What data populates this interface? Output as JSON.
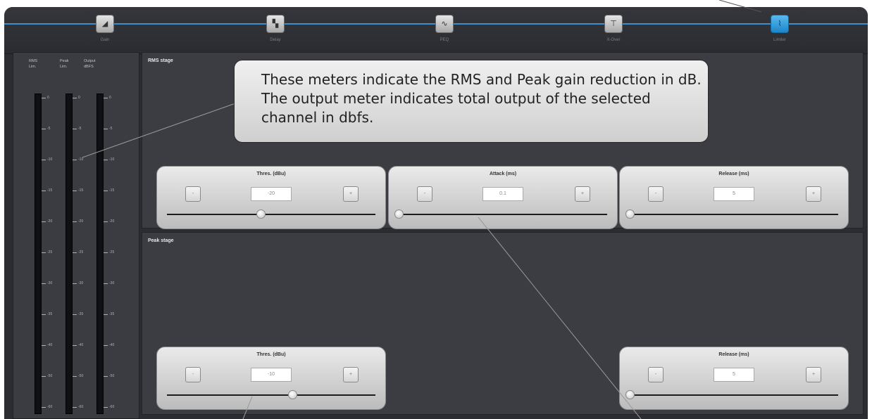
{
  "nav": {
    "items": [
      {
        "label": "Gain",
        "icon": "gain-icon"
      },
      {
        "label": "Delay",
        "icon": "delay-icon"
      },
      {
        "label": "PEQ",
        "icon": "peq-icon"
      },
      {
        "label": "X-Over",
        "icon": "crossover-icon"
      },
      {
        "label": "Limiter",
        "icon": "limiter-icon"
      }
    ],
    "active_index": 4
  },
  "meters": {
    "headers": [
      {
        "line1": "RMS",
        "line2": "Lim."
      },
      {
        "line1": "Peak",
        "line2": "Lim."
      },
      {
        "line1": "Output",
        "line2": "dBFS"
      }
    ],
    "scale": [
      "0",
      "-5",
      "-10",
      "-15",
      "-20",
      "-25",
      "-30",
      "-35",
      "-40",
      "-50",
      "-60"
    ]
  },
  "rms_stage": {
    "title": "RMS stage",
    "controls": [
      {
        "title": "Thres. (dBu)",
        "value": "-20",
        "minus": "-",
        "plus": "+",
        "level": 0.45
      },
      {
        "title": "Attack (ms)",
        "value": "0.1",
        "minus": "-",
        "plus": "+",
        "level": 0.0
      },
      {
        "title": "Release (ms)",
        "value": "5",
        "minus": "-",
        "plus": "+",
        "level": 0.0
      }
    ]
  },
  "peak_stage": {
    "title": "Peak stage",
    "controls": [
      {
        "title": "Thres. (dBu)",
        "value": "-10",
        "minus": "-",
        "plus": "+",
        "level": 0.6
      },
      {
        "title": "Release (ms)",
        "value": "5",
        "minus": "-",
        "plus": "+",
        "level": 0.0
      }
    ]
  },
  "callout": {
    "text": "These meters indicate the RMS and Peak gain reduction in dB. The output meter indicates total output of the selected channel in dbfs."
  },
  "colors": {
    "accent": "#3e8fc9",
    "active_button": "#2a9be0",
    "panel": "#3b3d43",
    "background": "#2b2d33"
  }
}
